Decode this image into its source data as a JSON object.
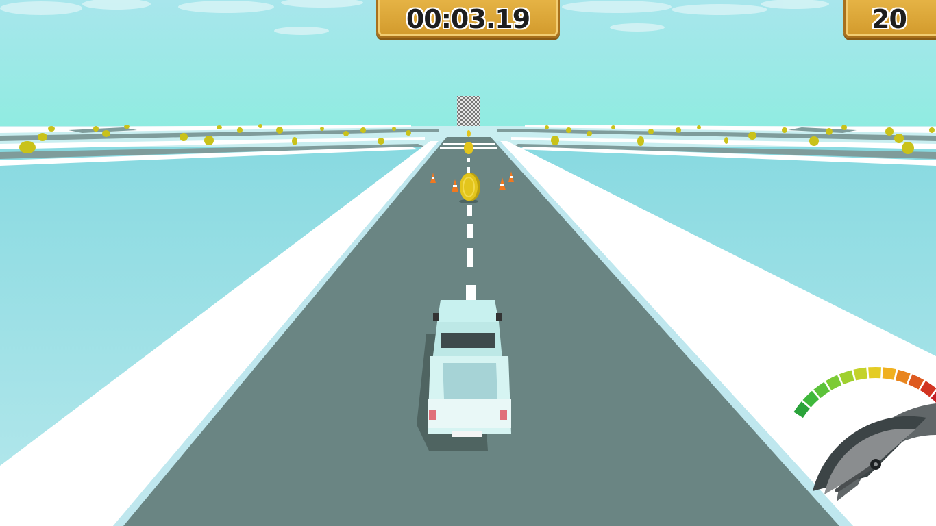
{
  "hud": {
    "timer": "00:03.19",
    "coin_count": "20"
  },
  "speedometer": {
    "needle_fraction": 0.18,
    "segment_colors": [
      "#2aa33a",
      "#3fb83c",
      "#5cc23a",
      "#7ccb34",
      "#9fd02e",
      "#c3d22a",
      "#e4cc24",
      "#f0b020",
      "#e8851e",
      "#de5a20",
      "#d23422",
      "#c41e24"
    ]
  },
  "colors": {
    "sky_top": "#a8e6ec",
    "sky_bottom": "#8eece0",
    "road": "#6a8583",
    "ground": "#a9e2e8",
    "coin": "#e3c51c",
    "hud_panel": "#d9a53a",
    "car_body": "#c8f1ef"
  },
  "scene": {
    "elements": [
      "road",
      "lane-markings",
      "traffic-cone",
      "coin",
      "pickup-truck",
      "checkered-finish-gate",
      "distant-road-grid",
      "trees",
      "clouds"
    ]
  }
}
